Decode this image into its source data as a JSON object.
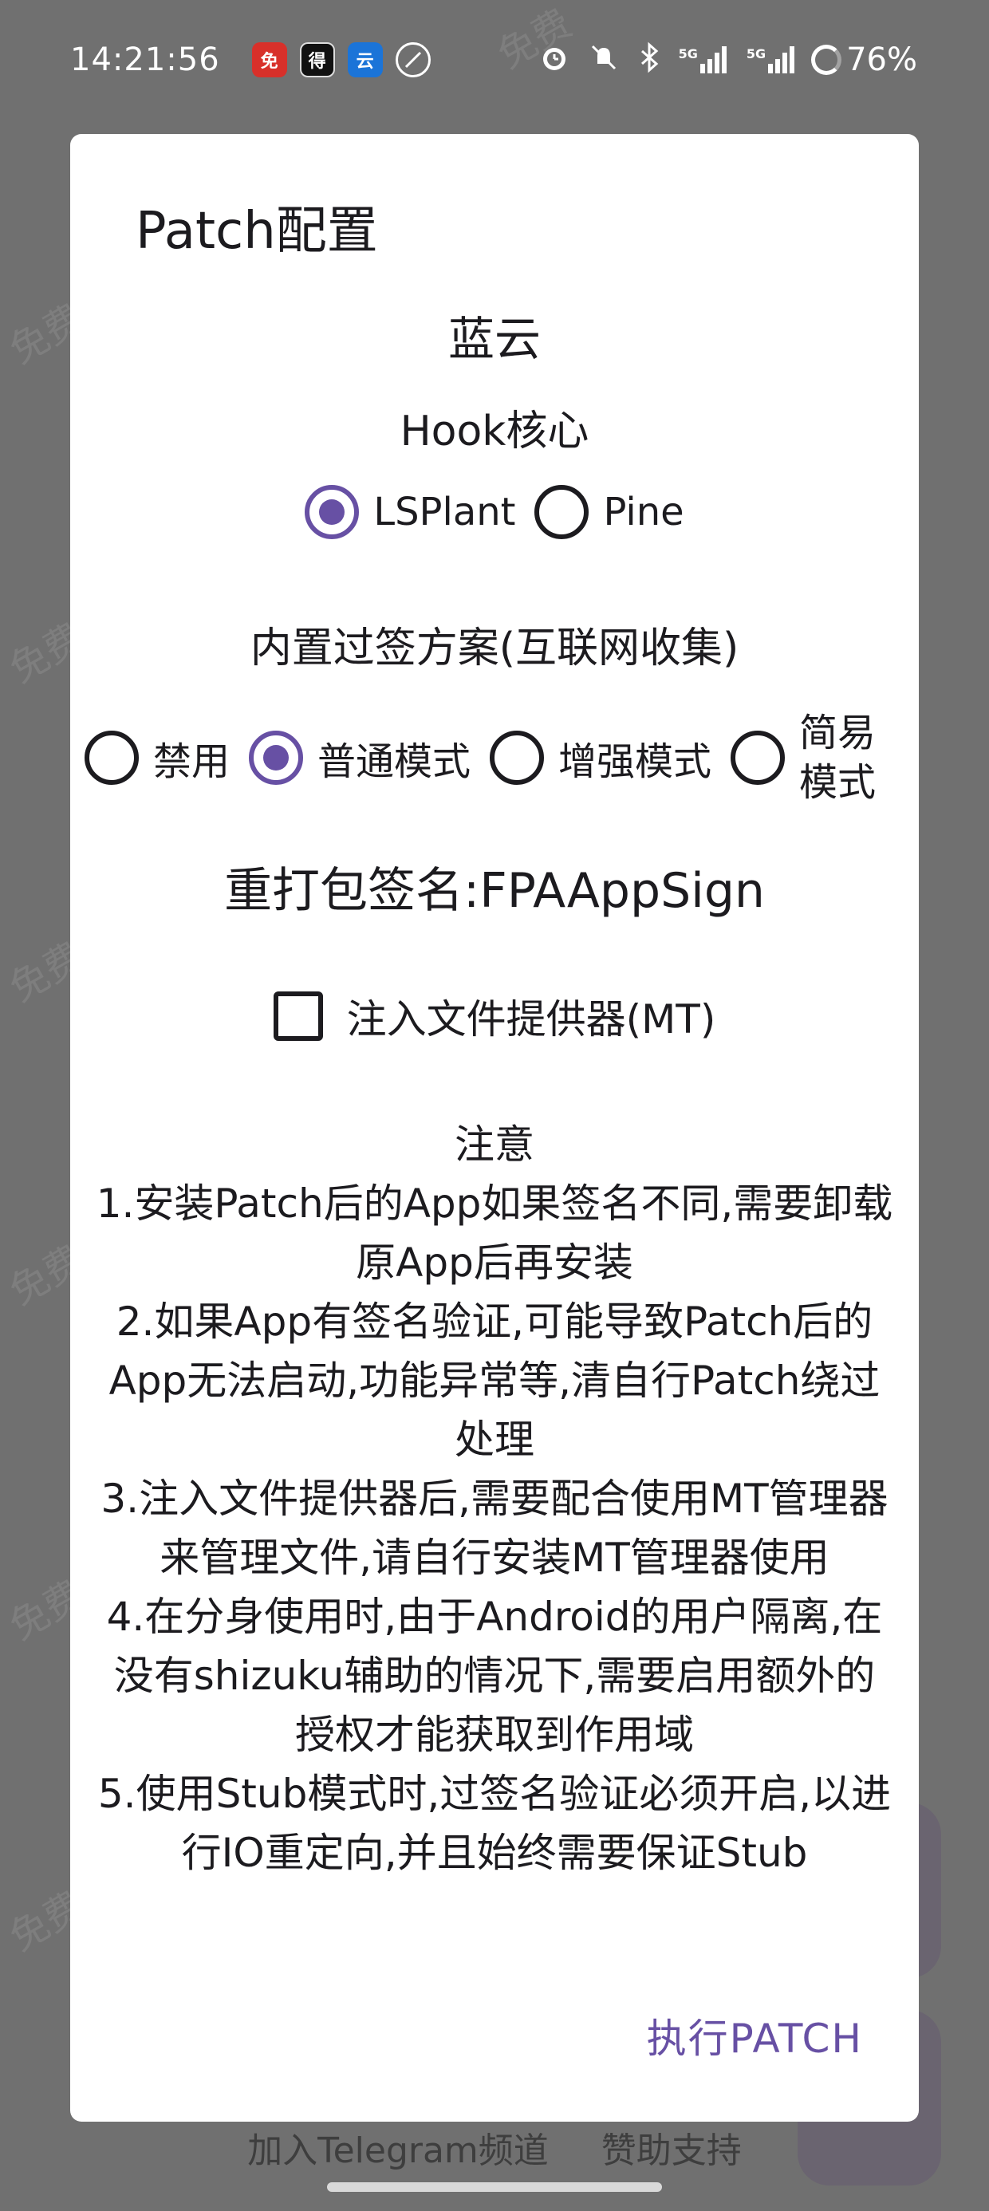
{
  "status_bar": {
    "time": "14:21:56",
    "battery": "76%",
    "network": [
      "5G",
      "5G"
    ],
    "app_icons": [
      "red-app-icon",
      "black-app-icon",
      "cloud-app-icon",
      "circle-slash-icon"
    ],
    "system_icons": [
      "alarm-icon",
      "mute-icon",
      "bluetooth-icon",
      "signal-icon",
      "signal-icon",
      "battery-icon"
    ],
    "app_icon_labels": {
      "icon1": "免",
      "icon2": "得",
      "icon3": "云"
    }
  },
  "watermark": "免费",
  "dialog": {
    "title": "Patch配置",
    "app_name": "蓝云",
    "hook_label": "Hook核心",
    "hook_options": [
      "LSPlant",
      "Pine"
    ],
    "hook_selected": "LSPlant",
    "sign_scheme_label": "内置过签方案(互联网收集)",
    "sign_scheme_options": [
      "禁用",
      "普通模式",
      "增强模式",
      "简易模式"
    ],
    "sign_scheme_selected": "普通模式",
    "resign_label": "重打包签名:FPAAppSign",
    "inject_provider_label": "注入文件提供器(MT)",
    "inject_provider_checked": false,
    "notes_title": "注意",
    "notes": [
      "1.安装Patch后的App如果签名不同,需要卸载原App后再安装",
      "2.如果App有签名验证,可能导致Patch后的App无法启动,功能异常等,清自行Patch绕过处理",
      "3.注入文件提供器后,需要配合使用MT管理器来管理文件,请自行安装MT管理器使用",
      "4.在分身使用时,由于Android的用户隔离,在没有shizuku辅助的情况下,需要启用额外的授权才能获取到作用域",
      "5.使用Stub模式时,过签名验证必须开启,以进行IO重定向,并且始终需要保证Stub"
    ],
    "action_label": "执行PATCH"
  },
  "background": {
    "telegram_link": "加入Telegram频道",
    "sponsor_link": "赞助支持"
  },
  "colors": {
    "accent": "#6750a4",
    "scrim": "#707070",
    "dialog_bg": "#ffffff"
  }
}
